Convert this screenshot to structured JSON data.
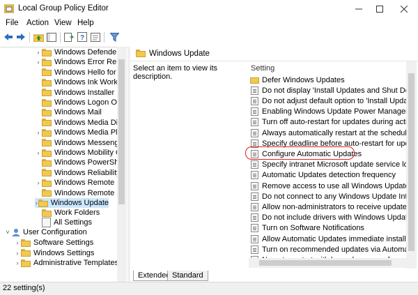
{
  "window": {
    "title": "Local Group Policy Editor"
  },
  "menu": [
    "File",
    "Action",
    "View",
    "Help"
  ],
  "toolbar": {
    "icons": [
      "back-arrow-icon",
      "forward-arrow-icon",
      "up-folder-icon",
      "show-hide-tree-icon",
      "export-list-icon",
      "help-icon",
      "properties-icon",
      "filter-icon"
    ]
  },
  "tree": {
    "items": [
      {
        "label": "Windows Defender",
        "expandable": true
      },
      {
        "label": "Windows Error Repo",
        "expandable": true
      },
      {
        "label": "Windows Hello for B",
        "expandable": false
      },
      {
        "label": "Windows Ink Worksp",
        "expandable": false
      },
      {
        "label": "Windows Installer",
        "expandable": false
      },
      {
        "label": "Windows Logon Opt",
        "expandable": false
      },
      {
        "label": "Windows Mail",
        "expandable": false
      },
      {
        "label": "Windows Media Digi",
        "expandable": false
      },
      {
        "label": "Windows Media Play",
        "expandable": true
      },
      {
        "label": "Windows Messenger",
        "expandable": false
      },
      {
        "label": "Windows Mobility C",
        "expandable": true
      },
      {
        "label": "Windows PowerShel",
        "expandable": false
      },
      {
        "label": "Windows Reliability /",
        "expandable": false
      },
      {
        "label": "Windows Remote M",
        "expandable": true
      },
      {
        "label": "Windows Remote Sh",
        "expandable": false
      },
      {
        "label": "Windows Update",
        "expandable": true,
        "selected": true
      },
      {
        "label": "Work Folders",
        "expandable": false
      }
    ],
    "all_settings": "All Settings",
    "user_configuration": "User Configuration",
    "user_children": [
      "Software Settings",
      "Windows Settings",
      "Administrative Templates"
    ]
  },
  "right": {
    "header": "Windows Update",
    "description": "Select an item to view its description.",
    "column_header": "Setting",
    "settings": [
      {
        "label": "Defer Windows Updates",
        "kind": "folder"
      },
      {
        "label": "Do not display 'Install Updates and Shut Down' opt",
        "kind": "policy"
      },
      {
        "label": "Do not adjust default option to 'Install Updates an",
        "kind": "policy"
      },
      {
        "label": "Enabling Windows Update Power Management to",
        "kind": "policy"
      },
      {
        "label": "Turn off auto-restart for updates during active hou",
        "kind": "policy"
      },
      {
        "label": "Always automatically restart at the scheduled time",
        "kind": "policy"
      },
      {
        "label": "Specify deadline before auto-restart for update ins",
        "kind": "policy"
      },
      {
        "label": "Configure Automatic Updates",
        "kind": "policy",
        "highlighted": true
      },
      {
        "label": "Specify intranet Microsoft update service location",
        "kind": "policy"
      },
      {
        "label": "Automatic Updates detection frequency",
        "kind": "policy"
      },
      {
        "label": "Remove access to use all Windows Update features",
        "kind": "policy"
      },
      {
        "label": "Do not connect to any Windows Update Internet lo",
        "kind": "policy"
      },
      {
        "label": "Allow non-administrators to receive update notific",
        "kind": "policy"
      },
      {
        "label": "Do not include drivers with Windows Updates",
        "kind": "policy"
      },
      {
        "label": "Turn on Software Notifications",
        "kind": "policy"
      },
      {
        "label": "Allow Automatic Updates immediate installation",
        "kind": "policy"
      },
      {
        "label": "Turn on recommended updates via Automatic Up",
        "kind": "policy"
      },
      {
        "label": "No auto-restart with logged on users for schedule",
        "kind": "policy"
      }
    ]
  },
  "tabs": [
    "Extended",
    "Standard"
  ],
  "status": "22 setting(s)",
  "colors": {
    "selection": "#cce8ff",
    "highlight_ring": "#e0201b",
    "folder": "#f2c94c"
  }
}
